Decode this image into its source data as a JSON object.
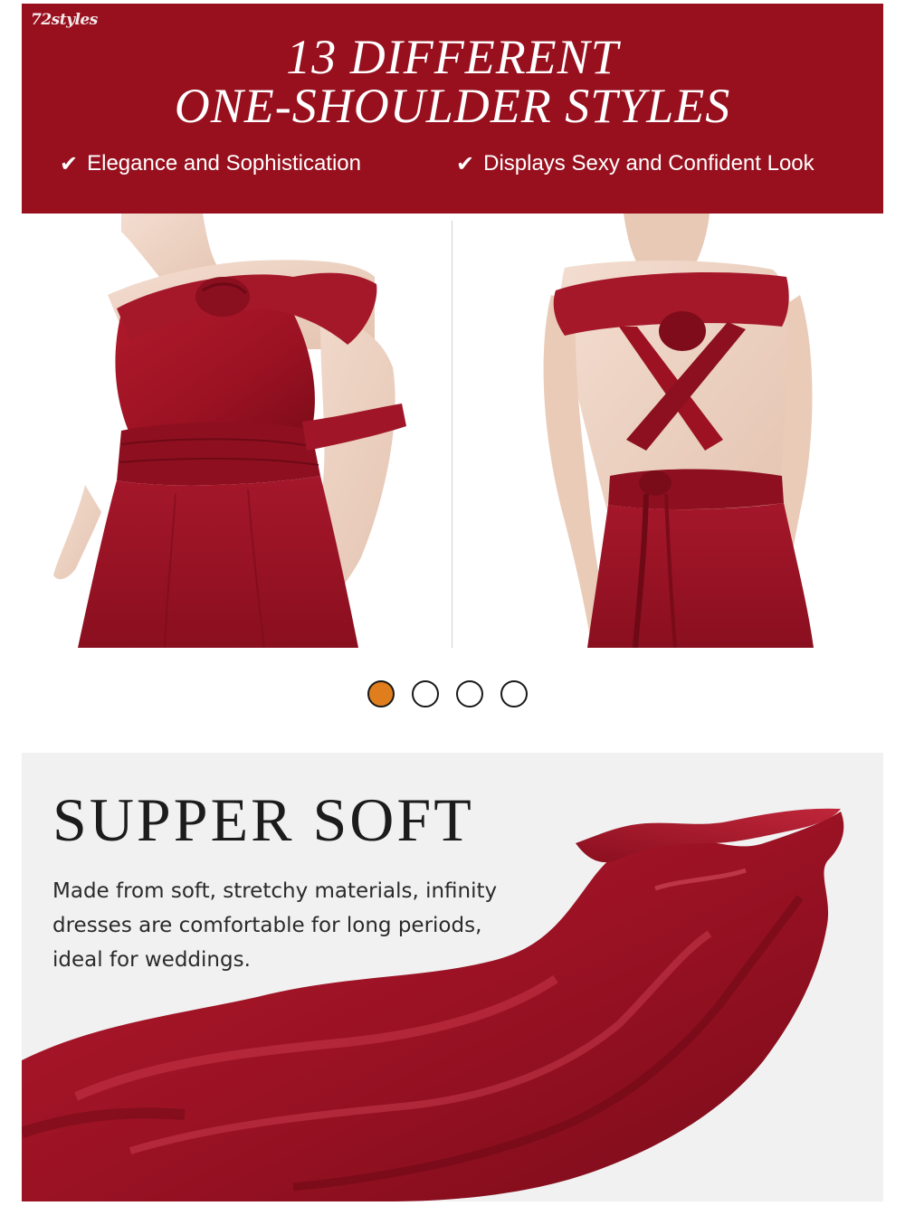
{
  "banner1": {
    "brand": "72styles",
    "title_line1": "13 DIFFERENT",
    "title_line2": "ONE-SHOULDER STYLES",
    "features": [
      {
        "icon": "checkmark-icon",
        "label": "Elegance and Sophistication"
      },
      {
        "icon": "checkmark-icon",
        "label": "Displays Sexy and Confident Look"
      }
    ],
    "photos": [
      "front-view-dress-photo",
      "back-view-dress-photo"
    ],
    "colors": {
      "banner_red": "#98101e",
      "dress_red": "#a11626"
    }
  },
  "carousel": {
    "current": 1,
    "total": 4,
    "active_color": "#e07e1e"
  },
  "banner2": {
    "title": "SUPPER SOFT",
    "body_lines": [
      "Made from soft, stretchy materials, infinity",
      "dresses are comfortable for long periods,",
      "ideal for weddings."
    ],
    "background_color": "#f1f1f1"
  }
}
